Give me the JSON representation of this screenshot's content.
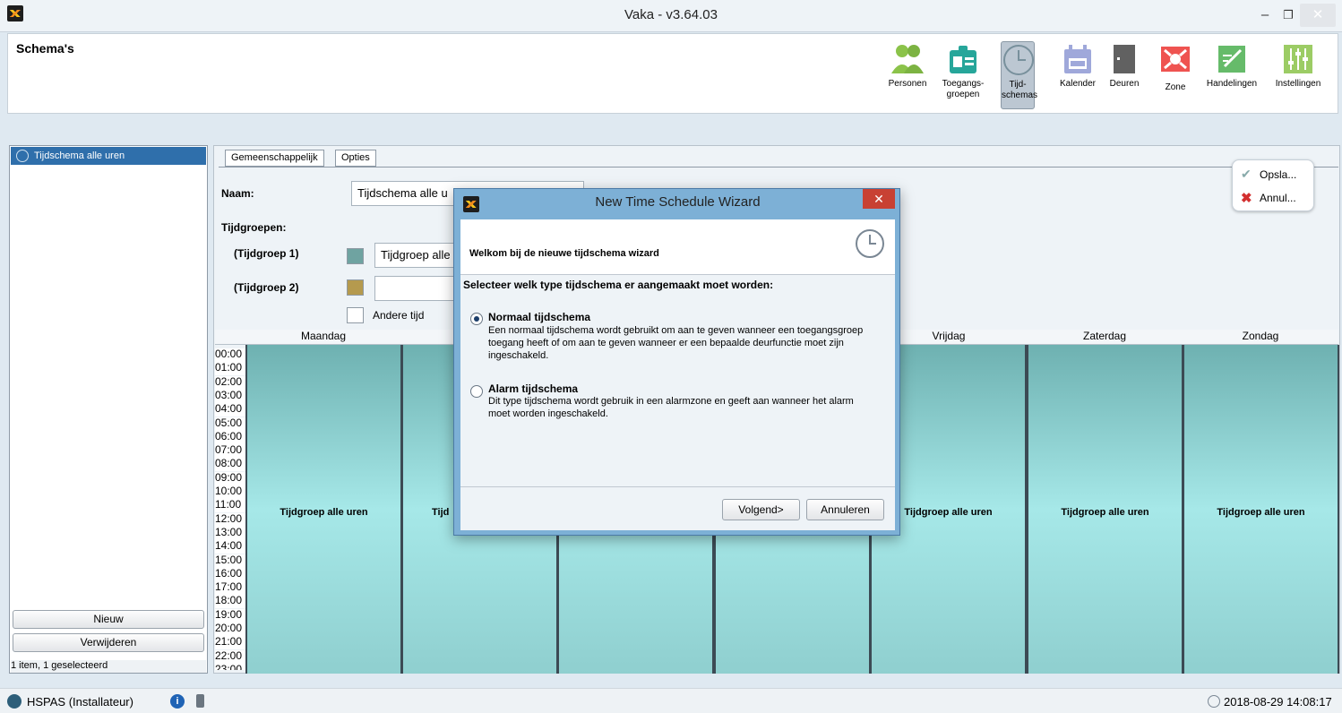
{
  "window": {
    "title": "Vaka - v3.64.03",
    "minimize": "–",
    "maximize": "❐",
    "close": "✕"
  },
  "page": {
    "title": "Schema's"
  },
  "toolbar": {
    "items": [
      {
        "label": "Personen",
        "icon": "persons-icon",
        "color": "#8bc34a"
      },
      {
        "label": "Toegangs-\ngroepen",
        "icon": "access-groups-icon",
        "color": "#26a69a"
      },
      {
        "label": "Tijd-\nschemas",
        "icon": "clock-icon",
        "color": "#90a4ae",
        "selected": true
      },
      {
        "label": "Kalender",
        "icon": "calendar-icon",
        "color": "#9fa8da"
      },
      {
        "label": "Deuren",
        "icon": "door-icon",
        "color": "#616161"
      },
      {
        "label": "Zone",
        "icon": "zone-icon",
        "color": "#ef5350"
      },
      {
        "label": "Handelingen",
        "icon": "actions-icon",
        "color": "#66bb6a"
      },
      {
        "label": "Instellingen",
        "icon": "settings-icon",
        "color": "#9ccc65"
      }
    ]
  },
  "left": {
    "selected_item": "Tijdschema alle uren",
    "new_button": "Nieuw",
    "delete_button": "Verwijderen",
    "status": "1 item, 1 geselecteerd"
  },
  "tabs": [
    "Gemeenschappelijk",
    "Opties"
  ],
  "form": {
    "name_label": "Naam:",
    "name_value": "Tijdschema alle u",
    "groups_label": "Tijdgroepen:",
    "group1_label": "(Tijdgroep 1)",
    "group1_value": "Tijdgroep alle",
    "group1_color": "#6fa3a1",
    "group2_label": "(Tijdgroep 2)",
    "group2_value": "",
    "group2_color": "#b59a4e",
    "other_time_label": "Andere tijd"
  },
  "actions": {
    "save": "Opsla...",
    "cancel": "Annul..."
  },
  "schedule": {
    "days": [
      "Maandag",
      "",
      "",
      "",
      "Vrijdag",
      "Zaterdag",
      "Zondag"
    ],
    "cell_labels": [
      "Tijdgroep alle uren",
      "Tijd",
      "",
      "",
      "Tijdgroep alle uren",
      "Tijdgroep alle uren",
      "Tijdgroep alle uren"
    ],
    "hours": [
      "00:00",
      "01:00",
      "02:00",
      "03:00",
      "04:00",
      "05:00",
      "06:00",
      "07:00",
      "08:00",
      "09:00",
      "10:00",
      "11:00",
      "12:00",
      "13:00",
      "14:00",
      "15:00",
      "16:00",
      "17:00",
      "18:00",
      "19:00",
      "20:00",
      "21:00",
      "22:00",
      "23:00"
    ]
  },
  "dialog": {
    "title": "New Time Schedule Wizard",
    "close": "✕",
    "header": "Welkom bij de nieuwe tijdschema wizard",
    "question": "Selecteer welk type tijdschema er aangemaakt moet worden:",
    "option1_title": "Normaal tijdschema",
    "option1_desc": "Een normaal tijdschema wordt gebruikt om aan te geven wanneer een toegangsgroep toegang heeft of om aan te geven wanneer er een bepaalde deurfunctie moet zijn ingeschakeld.",
    "option2_title": "Alarm tijdschema",
    "option2_desc": "Dit type tijdschema wordt gebruik in een alarmzone en geeft aan wanneer het alarm moet worden ingeschakeld.",
    "next_button": "Volgend>",
    "cancel_button": "Annuleren"
  },
  "statusbar": {
    "user": "HSPAS (Installateur)",
    "datetime": "2018-08-29 14:08:17"
  }
}
